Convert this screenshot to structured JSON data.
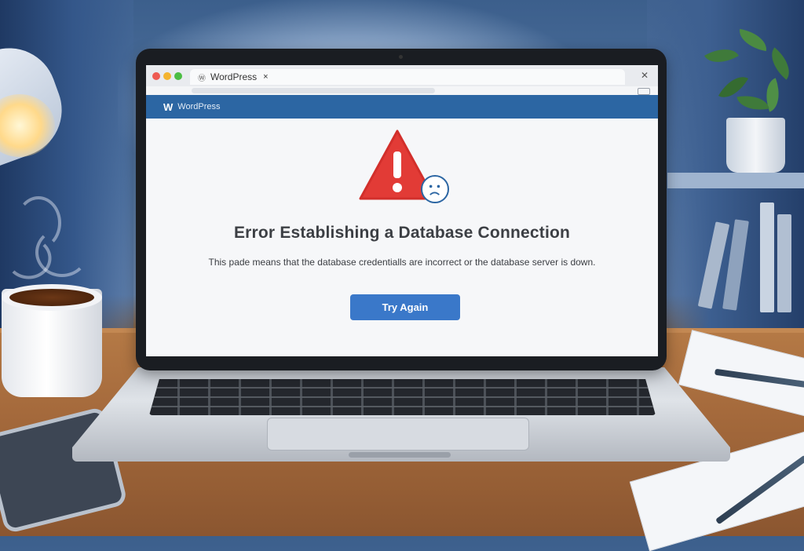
{
  "browser": {
    "tab_title": "WordPress",
    "tab_close": "×",
    "window_close": "✕"
  },
  "page": {
    "header_logo": "W",
    "header_text": "WordPress",
    "error_title": "Error Establishing a Database Connection",
    "error_description": "This pade means that the database credentialls are incorrect or the database server is down.",
    "try_again_label": "Try Again"
  },
  "icons": {
    "warning": "warning-triangle-icon",
    "sad_face": "sad-face-icon"
  },
  "colors": {
    "header": "#2c66a3",
    "warning": "#e23b36",
    "button": "#3a78c9"
  }
}
